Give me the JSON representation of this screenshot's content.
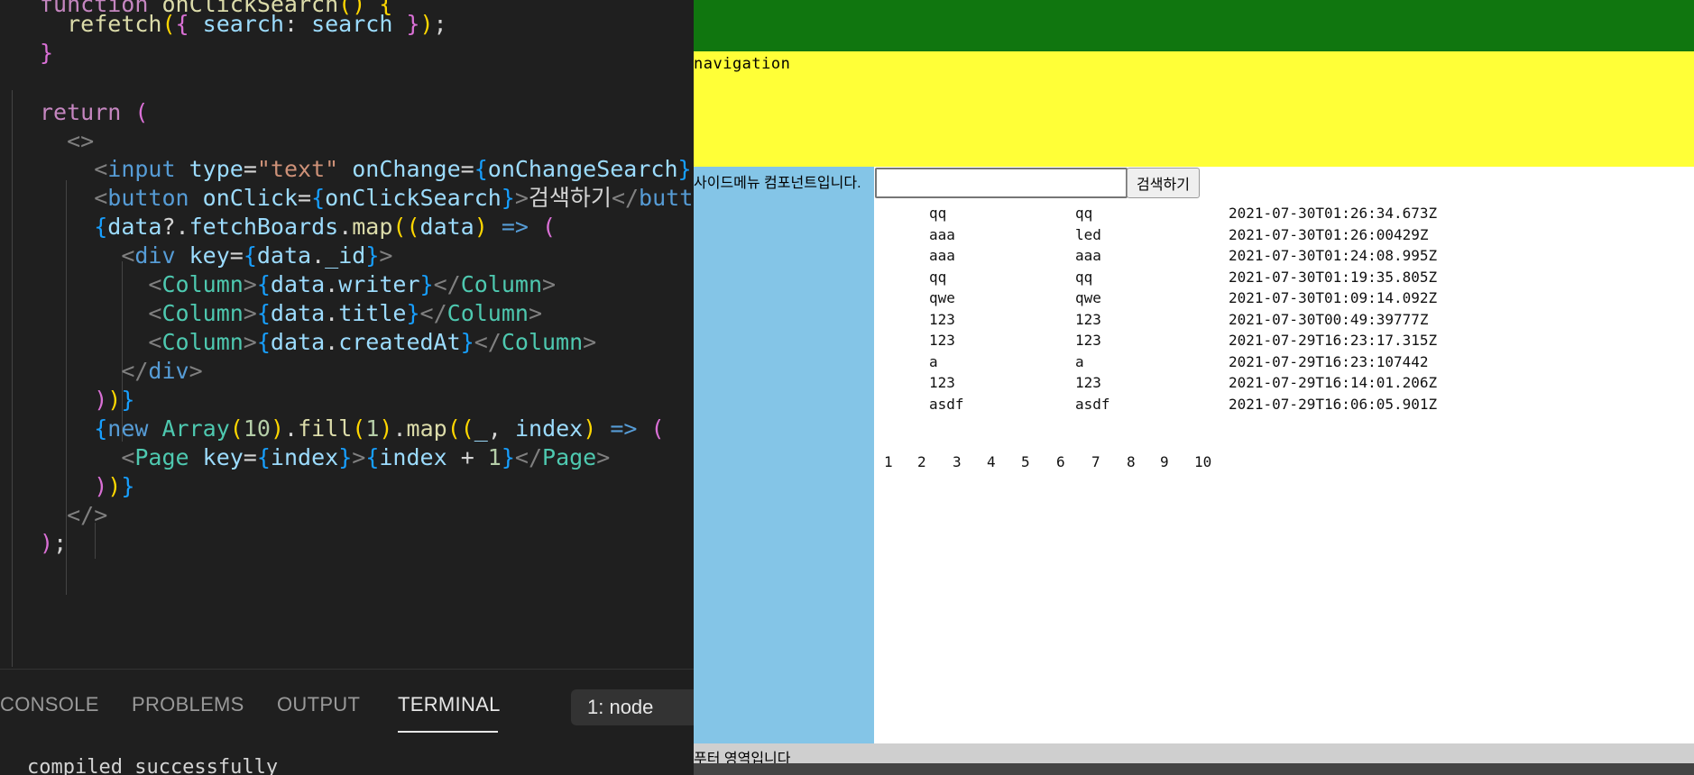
{
  "editor": {
    "lines": [
      [
        [
          "tok-kw",
          "function "
        ],
        [
          "tok-fn",
          "onClickSearch"
        ],
        [
          "tok-br1",
          "() {"
        ]
      ],
      [
        [
          "tok-plain",
          "  "
        ],
        [
          "tok-fn",
          "refetch"
        ],
        [
          "tok-br1",
          "("
        ],
        [
          "tok-br2",
          "{ "
        ],
        [
          "tok-var",
          "search"
        ],
        [
          "tok-plain",
          ": "
        ],
        [
          "tok-var",
          "search"
        ],
        [
          "tok-br2",
          " }"
        ],
        [
          "tok-br1",
          ")"
        ],
        [
          "tok-plain",
          ";"
        ]
      ],
      [
        [
          "tok-br2",
          "}"
        ]
      ],
      [
        [
          "tok-plain",
          ""
        ]
      ],
      [
        [
          "tok-kw",
          "return "
        ],
        [
          "tok-br2",
          "("
        ]
      ],
      [
        [
          "tok-plain",
          "  "
        ],
        [
          "tok-punc",
          "<>"
        ]
      ],
      [
        [
          "tok-plain",
          "    "
        ],
        [
          "tok-punc",
          "<"
        ],
        [
          "tok-tag",
          "input "
        ],
        [
          "tok-var",
          "type"
        ],
        [
          "tok-plain",
          "="
        ],
        [
          "tok-str",
          "\"text\""
        ],
        [
          "tok-var",
          " onChange"
        ],
        [
          "tok-plain",
          "="
        ],
        [
          "tok-br3",
          "{"
        ],
        [
          "tok-var",
          "onChangeSearch"
        ],
        [
          "tok-br3",
          "}"
        ]
      ],
      [
        [
          "tok-plain",
          "    "
        ],
        [
          "tok-punc",
          "<"
        ],
        [
          "tok-tag",
          "button "
        ],
        [
          "tok-var",
          "onClick"
        ],
        [
          "tok-plain",
          "="
        ],
        [
          "tok-br3",
          "{"
        ],
        [
          "tok-var",
          "onClickSearch"
        ],
        [
          "tok-br3",
          "}"
        ],
        [
          "tok-punc",
          ">"
        ],
        [
          "tok-plain",
          "검색하기"
        ],
        [
          "tok-punc",
          "</"
        ],
        [
          "tok-tag",
          "butt"
        ]
      ],
      [
        [
          "tok-plain",
          "    "
        ],
        [
          "tok-br3",
          "{"
        ],
        [
          "tok-var",
          "data"
        ],
        [
          "tok-plain",
          "?."
        ],
        [
          "tok-var",
          "fetchBoards"
        ],
        [
          "tok-plain",
          "."
        ],
        [
          "tok-fn",
          "map"
        ],
        [
          "tok-br1",
          "(("
        ],
        [
          "tok-var",
          "data"
        ],
        [
          "tok-br1",
          ") "
        ],
        [
          "tok-tag",
          "=>"
        ],
        [
          "tok-br2",
          " ("
        ]
      ],
      [
        [
          "tok-plain",
          "      "
        ],
        [
          "tok-punc",
          "<"
        ],
        [
          "tok-tag",
          "div "
        ],
        [
          "tok-var",
          "key"
        ],
        [
          "tok-plain",
          "="
        ],
        [
          "tok-br3",
          "{"
        ],
        [
          "tok-var",
          "data"
        ],
        [
          "tok-plain",
          "."
        ],
        [
          "tok-var",
          "_id"
        ],
        [
          "tok-br3",
          "}"
        ],
        [
          "tok-punc",
          ">"
        ]
      ],
      [
        [
          "tok-plain",
          "        "
        ],
        [
          "tok-punc",
          "<"
        ],
        [
          "tok-comp",
          "Column"
        ],
        [
          "tok-punc",
          ">"
        ],
        [
          "tok-br3",
          "{"
        ],
        [
          "tok-var",
          "data"
        ],
        [
          "tok-plain",
          "."
        ],
        [
          "tok-var",
          "writer"
        ],
        [
          "tok-br3",
          "}"
        ],
        [
          "tok-punc",
          "</"
        ],
        [
          "tok-comp",
          "Column"
        ],
        [
          "tok-punc",
          ">"
        ]
      ],
      [
        [
          "tok-plain",
          "        "
        ],
        [
          "tok-punc",
          "<"
        ],
        [
          "tok-comp",
          "Column"
        ],
        [
          "tok-punc",
          ">"
        ],
        [
          "tok-br3",
          "{"
        ],
        [
          "tok-var",
          "data"
        ],
        [
          "tok-plain",
          "."
        ],
        [
          "tok-var",
          "title"
        ],
        [
          "tok-br3",
          "}"
        ],
        [
          "tok-punc",
          "</"
        ],
        [
          "tok-comp",
          "Column"
        ],
        [
          "tok-punc",
          ">"
        ]
      ],
      [
        [
          "tok-plain",
          "        "
        ],
        [
          "tok-punc",
          "<"
        ],
        [
          "tok-comp",
          "Column"
        ],
        [
          "tok-punc",
          ">"
        ],
        [
          "tok-br3",
          "{"
        ],
        [
          "tok-var",
          "data"
        ],
        [
          "tok-plain",
          "."
        ],
        [
          "tok-var",
          "createdAt"
        ],
        [
          "tok-br3",
          "}"
        ],
        [
          "tok-punc",
          "</"
        ],
        [
          "tok-comp",
          "Column"
        ],
        [
          "tok-punc",
          ">"
        ]
      ],
      [
        [
          "tok-plain",
          "      "
        ],
        [
          "tok-punc",
          "</"
        ],
        [
          "tok-tag",
          "div"
        ],
        [
          "tok-punc",
          ">"
        ]
      ],
      [
        [
          "tok-plain",
          "    "
        ],
        [
          "tok-br2",
          ")"
        ],
        [
          "tok-br1",
          ")"
        ],
        [
          "tok-br3",
          "}"
        ]
      ],
      [
        [
          "tok-plain",
          "    "
        ],
        [
          "tok-br3",
          "{"
        ],
        [
          "tok-tag",
          "new "
        ],
        [
          "tok-comp",
          "Array"
        ],
        [
          "tok-br1",
          "("
        ],
        [
          "tok-num",
          "10"
        ],
        [
          "tok-br1",
          ")"
        ],
        [
          "tok-plain",
          "."
        ],
        [
          "tok-fn",
          "fill"
        ],
        [
          "tok-br1",
          "("
        ],
        [
          "tok-num",
          "1"
        ],
        [
          "tok-br1",
          ")"
        ],
        [
          "tok-plain",
          "."
        ],
        [
          "tok-fn",
          "map"
        ],
        [
          "tok-br1",
          "(("
        ],
        [
          "tok-var",
          "_"
        ],
        [
          "tok-plain",
          ", "
        ],
        [
          "tok-var",
          "index"
        ],
        [
          "tok-br1",
          ") "
        ],
        [
          "tok-tag",
          "=>"
        ],
        [
          "tok-br2",
          " ("
        ]
      ],
      [
        [
          "tok-plain",
          "      "
        ],
        [
          "tok-punc",
          "<"
        ],
        [
          "tok-comp",
          "Page "
        ],
        [
          "tok-var",
          "key"
        ],
        [
          "tok-plain",
          "="
        ],
        [
          "tok-br3",
          "{"
        ],
        [
          "tok-var",
          "index"
        ],
        [
          "tok-br3",
          "}"
        ],
        [
          "tok-punc",
          ">"
        ],
        [
          "tok-br3",
          "{"
        ],
        [
          "tok-var",
          "index"
        ],
        [
          "tok-plain",
          " + "
        ],
        [
          "tok-num",
          "1"
        ],
        [
          "tok-br3",
          "}"
        ],
        [
          "tok-punc",
          "</"
        ],
        [
          "tok-comp",
          "Page"
        ],
        [
          "tok-punc",
          ">"
        ]
      ],
      [
        [
          "tok-plain",
          "    "
        ],
        [
          "tok-br2",
          ")"
        ],
        [
          "tok-br1",
          ")"
        ],
        [
          "tok-br3",
          "}"
        ]
      ],
      [
        [
          "tok-plain",
          "  "
        ],
        [
          "tok-punc",
          "</>"
        ]
      ],
      [
        [
          "tok-br2",
          ")"
        ],
        [
          "tok-plain",
          ";"
        ]
      ]
    ]
  },
  "panel": {
    "tabs": [
      "CONSOLE",
      "PROBLEMS",
      "OUTPUT",
      "TERMINAL"
    ],
    "terminal_select": "1: node",
    "output_line": "compiled successfully"
  },
  "browser": {
    "navigation_text": "navigation",
    "sidemenu_text": "사이드메뉴 컴포넌트입니다.",
    "search_button": "검색하기",
    "search_value": "",
    "rows": [
      {
        "writer": "qq",
        "title": "qq",
        "createdAt": "2021-07-30T01:26:34.673Z"
      },
      {
        "writer": "aaa",
        "title": " led",
        "createdAt": "2021-07-30T01:26:00429Z"
      },
      {
        "writer": "aaa",
        "title": "aaa",
        "createdAt": "2021-07-30T01:24:08.995Z"
      },
      {
        "writer": "qq",
        "title": "qq",
        "createdAt": "2021-07-30T01:19:35.805Z"
      },
      {
        "writer": "qwe",
        "title": "qwe",
        "createdAt": "2021-07-30T01:09:14.092Z"
      },
      {
        "writer": "123",
        "title": "123",
        "createdAt": "2021-07-30T00:49:39777Z"
      },
      {
        "writer": "123",
        "title": "123",
        "createdAt": "2021-07-29T16:23:17.315Z"
      },
      {
        "writer": "a",
        "title": "a",
        "createdAt": "2021-07-29T16:23:107442"
      },
      {
        "writer": "123",
        "title": "123",
        "createdAt": "2021-07-29T16:14:01.206Z"
      },
      {
        "writer": "asdf",
        "title": "asdf",
        "createdAt": "2021-07-29T16:06:05.901Z"
      }
    ],
    "pages": [
      "1",
      "2",
      "3",
      "4",
      "5",
      "6",
      "7",
      "8",
      "9",
      "10"
    ],
    "footer_text": "푸터 영역입니다"
  }
}
